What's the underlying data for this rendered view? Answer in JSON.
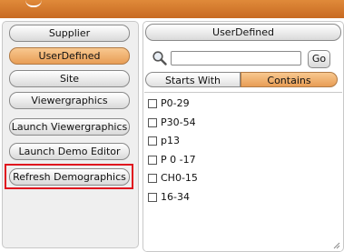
{
  "left_menu": {
    "items": [
      {
        "label": "Supplier",
        "selected": false
      },
      {
        "label": "UserDefined",
        "selected": true
      },
      {
        "label": "Site",
        "selected": false
      },
      {
        "label": "Viewergraphics",
        "selected": false
      },
      {
        "label": "Launch Viewergraphics",
        "selected": false
      },
      {
        "label": "Launch Demo Editor",
        "selected": false
      },
      {
        "label": "Refresh Demographics",
        "selected": false
      }
    ]
  },
  "right_panel": {
    "header": "UserDefined",
    "search": {
      "value": "",
      "placeholder": "",
      "go_label": "Go"
    },
    "match_modes": {
      "starts_with": "Starts With",
      "contains": "Contains",
      "active": "contains"
    },
    "items": [
      "P0-29",
      "P30-54",
      "p13",
      "P 0 -17",
      "CH0-15",
      "16-34"
    ]
  },
  "colors": {
    "accent_orange": "#e89d55",
    "topbar": "#d27a2e",
    "highlight_red": "#e0141e"
  }
}
